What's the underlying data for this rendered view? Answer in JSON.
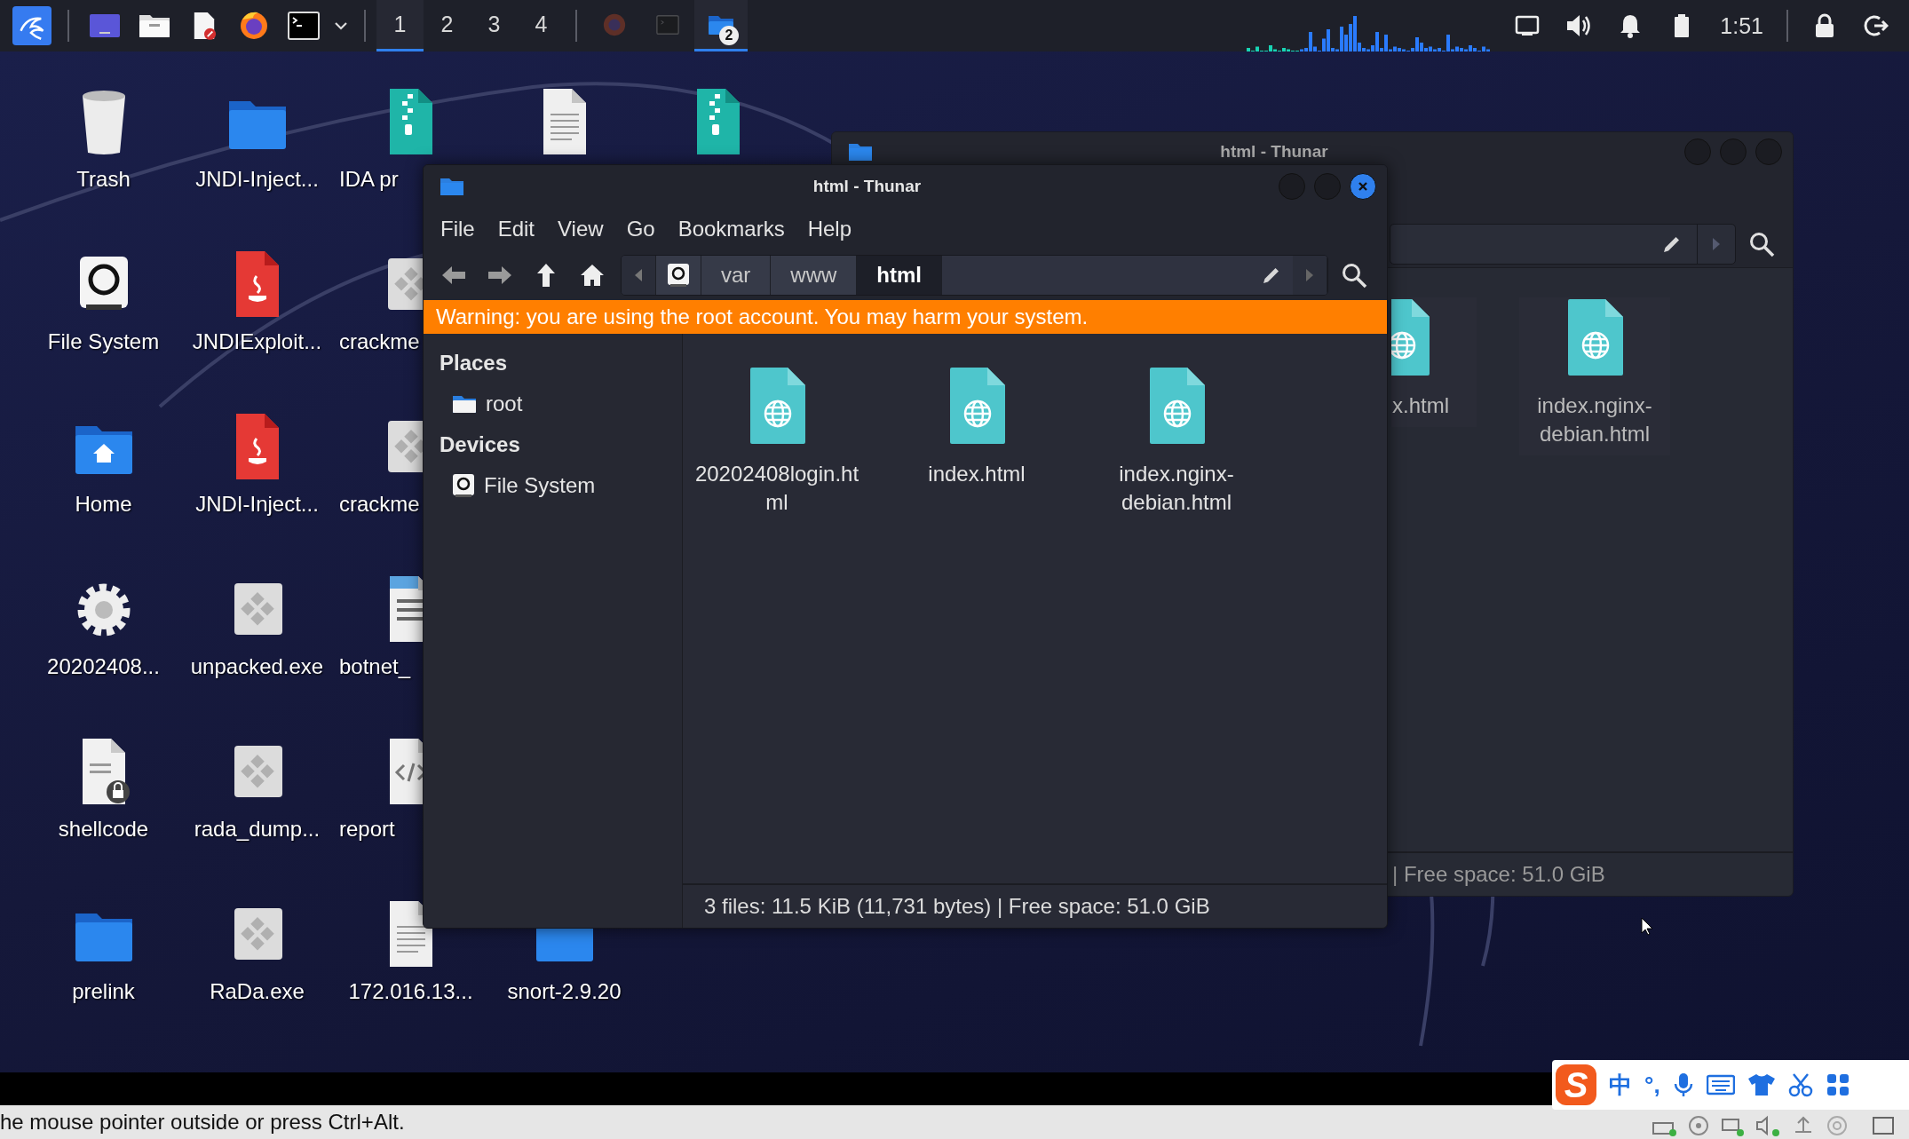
{
  "top_panel": {
    "workspaces": [
      {
        "label": "1",
        "selected": true
      },
      {
        "label": "2",
        "selected": false
      },
      {
        "label": "3",
        "selected": false
      },
      {
        "label": "4",
        "selected": false
      }
    ],
    "tasks": [
      {
        "kind": "browser",
        "selected": false
      },
      {
        "kind": "terminal",
        "selected": false
      },
      {
        "kind": "folder",
        "selected": true,
        "badge": "2"
      }
    ],
    "clock": "1:51"
  },
  "desktop": {
    "rows": [
      [
        {
          "label": "Trash",
          "kind": "trash"
        },
        {
          "label": "JNDI-Inject...",
          "kind": "folder"
        },
        {
          "label": "IDA pr",
          "kind": "archive",
          "clipped": true
        },
        {
          "kind": "document"
        },
        {
          "kind": "archive"
        }
      ],
      [
        {
          "label": "File System",
          "kind": "drive"
        },
        {
          "label": "JNDIExploit...",
          "kind": "java"
        },
        {
          "label": "crackme",
          "kind": "exe",
          "clipped": true
        }
      ],
      [
        {
          "label": "Home",
          "kind": "home"
        },
        {
          "label": "JNDI-Inject...",
          "kind": "java"
        },
        {
          "label": "crackme",
          "kind": "exe",
          "clipped": true
        }
      ],
      [
        {
          "label": "20202408...",
          "kind": "gear"
        },
        {
          "label": "unpacked.exe",
          "kind": "exe"
        },
        {
          "label": "botnet_",
          "kind": "binary",
          "clipped": true
        }
      ],
      [
        {
          "label": "shellcode",
          "kind": "locked"
        },
        {
          "label": "rada_dump...",
          "kind": "exe"
        },
        {
          "label": "report",
          "kind": "script",
          "clipped": true
        }
      ],
      [
        {
          "label": "prelink",
          "kind": "folder"
        },
        {
          "label": "RaDa.exe",
          "kind": "exe"
        },
        {
          "label": "172.016.13...",
          "kind": "document"
        },
        {
          "label": "snort-2.9.20",
          "kind": "folder"
        }
      ]
    ]
  },
  "back_window": {
    "title": "html - Thunar",
    "files": [
      {
        "lines": [
          "x.html"
        ],
        "clipped": true
      },
      {
        "lines": [
          "index.nginx-",
          "debian.html"
        ],
        "clipped": false
      }
    ],
    "status": "| Free space: 51.0 GiB"
  },
  "window": {
    "title": "html - Thunar",
    "menu": [
      "File",
      "Edit",
      "View",
      "Go",
      "Bookmarks",
      "Help"
    ],
    "path": [
      {
        "kind": "drive",
        "selected": false
      },
      {
        "label": "var",
        "selected": false
      },
      {
        "label": "www",
        "selected": false
      },
      {
        "label": "html",
        "selected": true
      }
    ],
    "warning": "Warning: you are using the root account. You may harm your system.",
    "sidebar": [
      {
        "title": "Places",
        "items": [
          {
            "label": "root",
            "kind": "folder"
          }
        ]
      },
      {
        "title": "Devices",
        "items": [
          {
            "label": "File System",
            "kind": "drive"
          }
        ]
      }
    ],
    "files": [
      {
        "lines": [
          "20202408login.ht",
          "ml"
        ]
      },
      {
        "lines": [
          "index.html"
        ]
      },
      {
        "lines": [
          "index.nginx-",
          "debian.html"
        ]
      }
    ],
    "status": "3 files: 11.5 KiB (11,731 bytes) | Free space: 51.0 GiB"
  },
  "ime_bar": {
    "logo": "S",
    "items": [
      "中",
      "°,"
    ]
  },
  "host_status": {
    "message": "he mouse pointer outside or press Ctrl+Alt."
  }
}
